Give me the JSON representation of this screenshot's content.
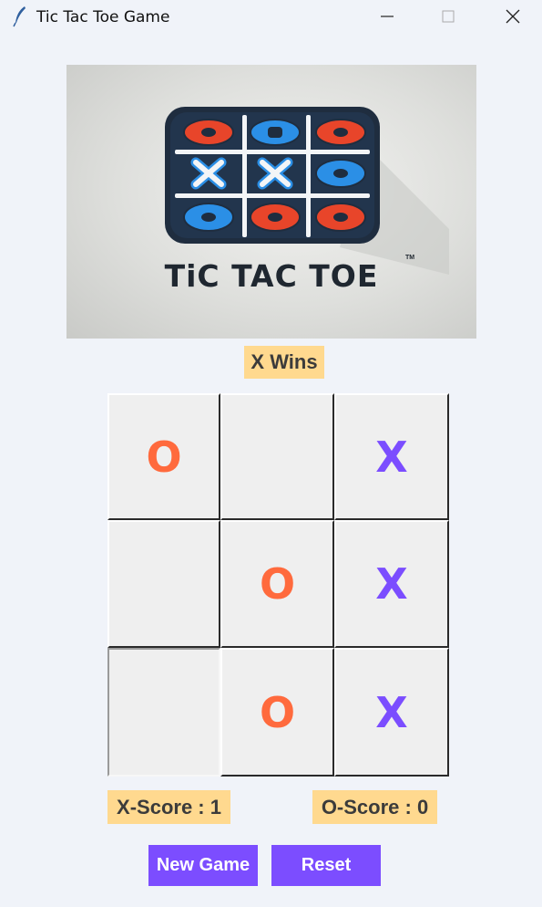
{
  "window": {
    "title": "Tic Tac Toe Game",
    "icon": "feather-icon",
    "controls": [
      "minimize-icon",
      "maximize-icon",
      "close-icon"
    ]
  },
  "logo": {
    "text": "TiC TAC TOE",
    "tm": "TM",
    "grid_marks": [
      "O",
      "O",
      "O",
      "X",
      "X",
      "O",
      "O",
      "O",
      "O"
    ],
    "colors": {
      "red": "#e8452a",
      "blue": "#2b8fe6",
      "frame": "#1f2d3f"
    }
  },
  "status": "X Wins",
  "board": {
    "cells": [
      "O",
      "",
      "X",
      "",
      "O",
      "X",
      "",
      "O",
      "X"
    ]
  },
  "scores": {
    "x": "X-Score : 1",
    "o": "O-Score : 0"
  },
  "buttons": {
    "new_game": "New Game",
    "reset": "Reset"
  },
  "colors": {
    "background": "#f0f3f9",
    "label_bg": "#ffd98f",
    "button_bg": "#7c4dff",
    "o_color": "#ff6a3d",
    "x_color": "#7b4dff"
  }
}
